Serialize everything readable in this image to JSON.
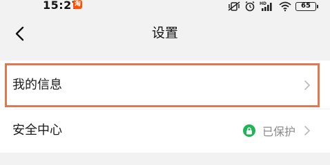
{
  "status_bar": {
    "time": "15:27",
    "app_badge": "淘",
    "battery": "65"
  },
  "nav": {
    "title": "设置"
  },
  "settings": {
    "items": [
      {
        "label": "我的信息"
      },
      {
        "label": "安全中心",
        "status": "已保护"
      }
    ]
  },
  "colors": {
    "background": "#f2f2f2",
    "card": "#ffffff",
    "highlight_border": "#e0784f",
    "secure_green": "#1fb455",
    "muted_text": "#8a8a8a"
  },
  "icons": {
    "back": "chevron-left-icon",
    "row_arrow": "chevron-right-icon",
    "security": "lock-icon"
  }
}
